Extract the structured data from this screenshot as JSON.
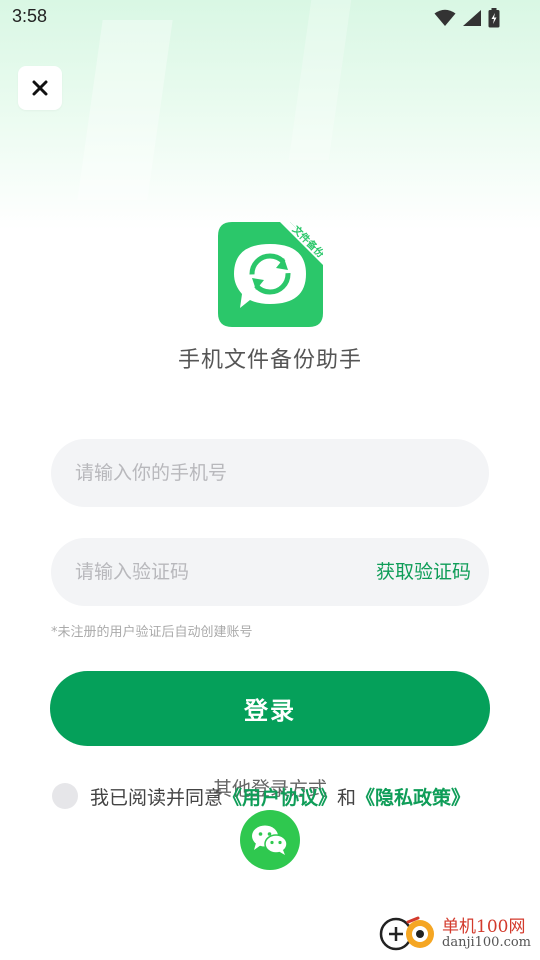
{
  "status_bar": {
    "time": "3:58",
    "icons": [
      "wifi-icon",
      "signal-icon",
      "battery-charging-icon"
    ]
  },
  "close": {
    "icon": "close-icon"
  },
  "app": {
    "name": "手机文件备份助手",
    "logo_badge": "文件备份",
    "brand_color": "#2bc76a"
  },
  "form": {
    "phone_placeholder": "请输入你的手机号",
    "phone_value": "",
    "code_placeholder": "请输入验证码",
    "code_value": "",
    "get_code_label": "获取验证码",
    "register_hint": "*未注册的用户验证后自动创建账号",
    "login_label": "登录"
  },
  "agreement": {
    "prefix": "我已阅读并同意",
    "user_agreement": "《用户协议》",
    "and": "和",
    "privacy_policy": "《隐私政策》",
    "checked": false
  },
  "other_login": {
    "title": "其他登录方式",
    "wechat_icon": "wechat-icon"
  },
  "watermark": {
    "name": "单机100网",
    "url": "danji100.com"
  },
  "colors": {
    "accent": "#05a05a",
    "link": "#0f9d58",
    "input_bg": "#f3f4f6",
    "wechat": "#2fc84f"
  }
}
